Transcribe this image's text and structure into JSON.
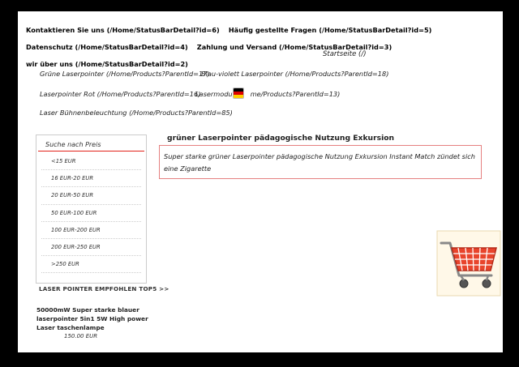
{
  "top_links": [
    "Kontaktieren Sie uns (/Home/StatusBarDetail?id=6)",
    "Häufig gestellte Fragen (/Home/StatusBarDetail?id=5)",
    "Datenschutz (/Home/StatusBarDetail?id=4)",
    "Zahlung und Versand (/Home/StatusBarDetail?id=3)",
    "wir über uns (/Home/StatusBarDetail?id=2)"
  ],
  "startseite": "Startseite (/)",
  "nav": {
    "gruene": "Grüne Laserpointer (/Home/Products?ParentId=17)",
    "blau": "Blau-violett Laserpointer (/Home/Products?ParentId=18)",
    "rot": "Laserpointer Rot (/Home/Products?ParentId=16)",
    "modul_a": "Lasermodul (",
    "modul_b": "me/Products?ParentId=13)",
    "buehne": "Laser Bühnenbeleuchtung (/Home/Products?ParentId=85)"
  },
  "sidebar": {
    "title": "Suche nach Preis",
    "prices": [
      "<15 EUR",
      "16 EUR-20 EUR",
      "20 EUR-50 EUR",
      "50 EUR-100 EUR",
      "100 EUR-200 EUR",
      "200 EUR-250 EUR",
      ">250 EUR"
    ]
  },
  "recommend": "LASER POINTER EMPFOHLEN TOP5 >>",
  "product": {
    "name": "50000mW Super starke blauer laserpointer 5in1 5W High power Laser taschenlampe",
    "price": "150.00 EUR"
  },
  "main": {
    "title": "grüner Laserpointer pädagogische Nutzung Exkursion",
    "description": "Super starke grüner Laserpointer pädagogische Nutzung Exkursion Instant Match zündet sich eine Zigarette"
  },
  "colors": {
    "accent_red": "#e2231a",
    "cart_red": "#e8442c"
  },
  "icons": [
    "flag-icon",
    "shopping-cart-icon"
  ]
}
